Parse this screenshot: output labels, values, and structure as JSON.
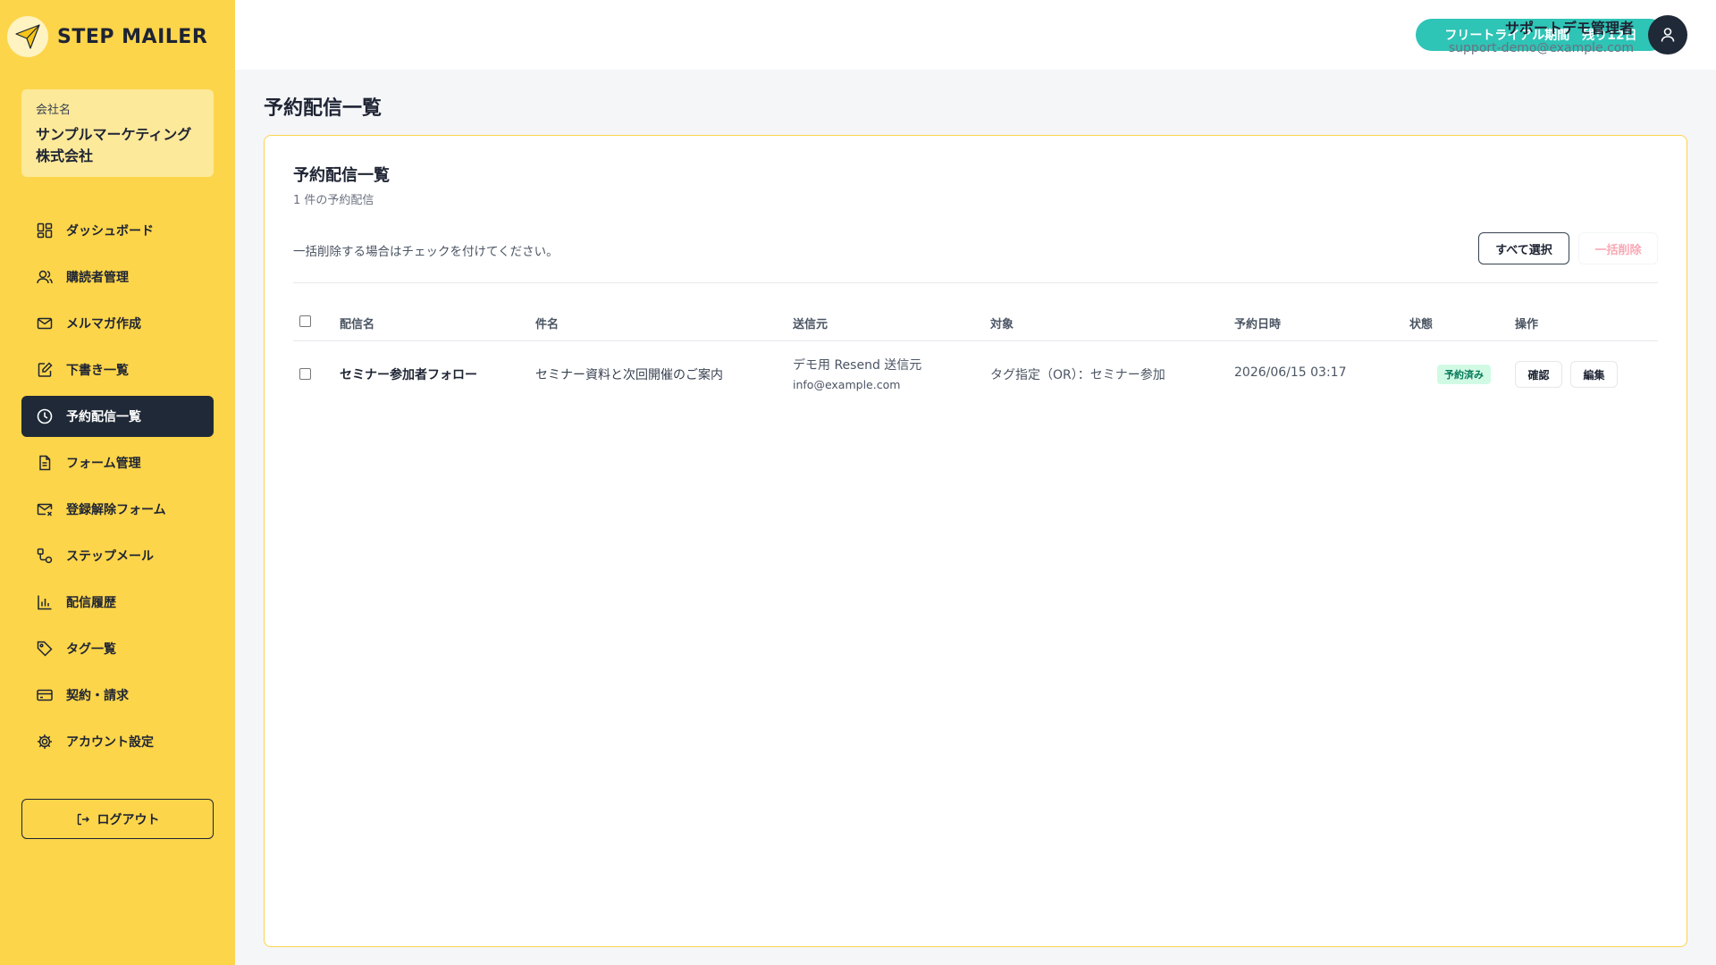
{
  "brand": {
    "name": "STEP MAILER"
  },
  "company": {
    "label": "会社名",
    "name": "サンプルマーケティング株式会社"
  },
  "sidebar": {
    "items": [
      {
        "label": "ダッシュボード",
        "icon": "dashboard-icon"
      },
      {
        "label": "購読者管理",
        "icon": "users-icon"
      },
      {
        "label": "メルマガ作成",
        "icon": "mail-icon"
      },
      {
        "label": "下書き一覧",
        "icon": "edit-icon"
      },
      {
        "label": "予約配信一覧",
        "icon": "clock-icon",
        "active": true
      },
      {
        "label": "フォーム管理",
        "icon": "document-icon"
      },
      {
        "label": "登録解除フォーム",
        "icon": "mail-x-icon"
      },
      {
        "label": "ステップメール",
        "icon": "workflow-icon"
      },
      {
        "label": "配信履歴",
        "icon": "bar-chart-icon"
      },
      {
        "label": "タグ一覧",
        "icon": "tag-icon"
      },
      {
        "label": "契約・請求",
        "icon": "credit-card-icon"
      },
      {
        "label": "アカウント設定",
        "icon": "gear-icon"
      }
    ],
    "logout_label": "ログアウト"
  },
  "header": {
    "trial_label": "フリートライアル期間　残り12日",
    "user_name": "サポートデモ管理者",
    "user_email": "support-demo@example.com"
  },
  "page": {
    "title": "予約配信一覧"
  },
  "card": {
    "title": "予約配信一覧",
    "subtitle": "1 件の予約配信",
    "note": "一括削除する場合はチェックを付けてください。",
    "select_all_label": "すべて選択",
    "bulk_delete_label": "一括削除"
  },
  "table": {
    "headers": [
      "配信名",
      "件名",
      "送信元",
      "対象",
      "予約日時",
      "状態",
      "操作"
    ],
    "rows": [
      {
        "name": "セミナー参加者フォロー",
        "subject": "セミナー資料と次回開催のご案内",
        "sender_name": "デモ用 Resend 送信元",
        "sender_email": "info@example.com",
        "target": "タグ指定（OR）：セミナー参加",
        "datetime": "2026/06/15 03:17",
        "status": "予約済み",
        "action_view": "確認",
        "action_edit": "編集"
      }
    ]
  },
  "colors": {
    "sidebar_bg": "#fdd54a",
    "nav_active_bg": "#1f2937",
    "trial_bg": "#2ec4b6",
    "status_badge_bg": "#d1fae5",
    "status_badge_text": "#047857"
  }
}
